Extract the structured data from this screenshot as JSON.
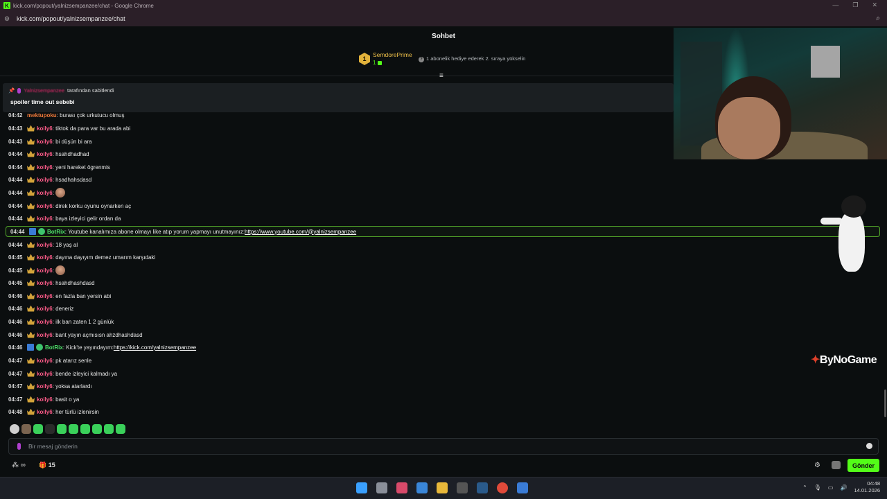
{
  "window": {
    "title": "kick.com/popout/yalnizsempanzee/chat - Google Chrome",
    "url": "kick.com/popout/yalnizsempanzee/chat"
  },
  "chat_header": {
    "title": "Sohbet"
  },
  "leaderboard": {
    "rank": "1",
    "name": "SemdorePrime",
    "count": "1",
    "info": "1 abonelik hediye ederek 2. sıraya yükselin"
  },
  "pinned": {
    "pinned_by": "Yalnizsempanzee",
    "pinned_label": "tarafından sabitlendi",
    "message": "spoiler time out sebebi"
  },
  "messages": [
    {
      "time": "04:42",
      "user": "mektupoku",
      "text": ": burası çok urkutucu olmuş"
    },
    {
      "time": "04:43",
      "user": "koily6",
      "text": ": tiktok da para var bu arada abi"
    },
    {
      "time": "04:43",
      "user": "koily6",
      "text": ": bi düşün bi ara"
    },
    {
      "time": "04:44",
      "user": "koily6",
      "text": ": hsahdhadhad"
    },
    {
      "time": "04:44",
      "user": "koily6",
      "text": ": yeni hareket ögrenmis"
    },
    {
      "time": "04:44",
      "user": "koily6",
      "text": ": hsadhahsdasd"
    },
    {
      "time": "04:44",
      "user": "koily6",
      "text": ":"
    },
    {
      "time": "04:44",
      "user": "koily6",
      "text": ": direk korku oyunu oynarken aç"
    },
    {
      "time": "04:44",
      "user": "koily6",
      "text": ": baya izleyici gelir ordan da"
    },
    {
      "time": "04:44",
      "user": "BotRix",
      "text": ": Youtube kanalımıza abone olmayı like atıp yorum yapmayı unutmayınız: ",
      "link": "https://www.youtube.com/@yalnizsempanzee"
    },
    {
      "time": "04:44",
      "user": "koily6",
      "text": ": 18 yaş al"
    },
    {
      "time": "04:45",
      "user": "koily6",
      "text": ": dayına dayıyım demez umarım karşıdaki"
    },
    {
      "time": "04:45",
      "user": "koily6",
      "text": ":"
    },
    {
      "time": "04:45",
      "user": "koily6",
      "text": ": hsahdhashdasd"
    },
    {
      "time": "04:46",
      "user": "koily6",
      "text": ": en fazla ban yersin abi"
    },
    {
      "time": "04:46",
      "user": "koily6",
      "text": ": deneriz"
    },
    {
      "time": "04:46",
      "user": "koily6",
      "text": ": ilk ban zaten 1 2 günlük"
    },
    {
      "time": "04:46",
      "user": "koily6",
      "text": ": bant yayın açmısısn ahzdhashdasd"
    },
    {
      "time": "04:46",
      "user": "BotRix",
      "text": ": Kick'te yayındayım: ",
      "link": "https://kick.com/yalnizsempanzee"
    },
    {
      "time": "04:47",
      "user": "koily6",
      "text": ": pk atarız senle"
    },
    {
      "time": "04:47",
      "user": "koily6",
      "text": ": bende izleyici kalmadı ya"
    },
    {
      "time": "04:47",
      "user": "koily6",
      "text": ": yoksa atarlardı"
    },
    {
      "time": "04:47",
      "user": "koily6",
      "text": ": basit o ya"
    },
    {
      "time": "04:48",
      "user": "koily6",
      "text": ": her türlü izlenirsin"
    }
  ],
  "input": {
    "placeholder": "Bir mesaj gönderin"
  },
  "bottombar": {
    "viewers_icon": "∞",
    "gift_count": "15",
    "send_label": "Gönder"
  },
  "overlay": {
    "brand": "ByNoGame"
  },
  "taskbar": {
    "time": "04:48",
    "date": "14.01.2026"
  },
  "colors": {
    "accent": "#53fc18",
    "username": "#ff5c8a",
    "bot": "#4ee26a"
  }
}
